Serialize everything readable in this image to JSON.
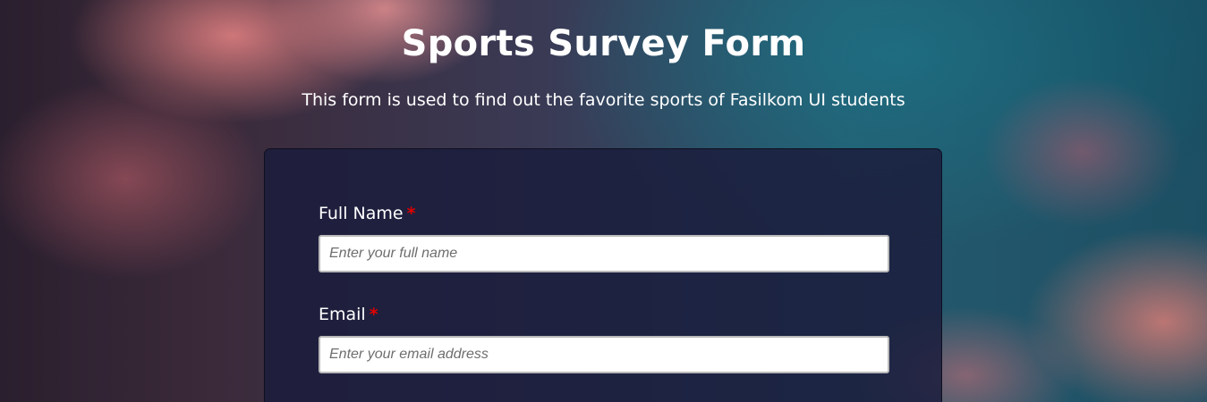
{
  "header": {
    "title": "Sports Survey Form",
    "description": "This form is used to find out the favorite sports of Fasilkom UI students"
  },
  "form": {
    "fields": [
      {
        "label": "Full Name",
        "required_marker": "*",
        "placeholder": "Enter your full name",
        "value": ""
      },
      {
        "label": "Email",
        "required_marker": "*",
        "placeholder": "Enter your email address",
        "value": ""
      }
    ]
  },
  "colors": {
    "text": "#ffffff",
    "required": "#e00000",
    "card_background": "#1b1d3c",
    "input_background": "#ffffff"
  }
}
